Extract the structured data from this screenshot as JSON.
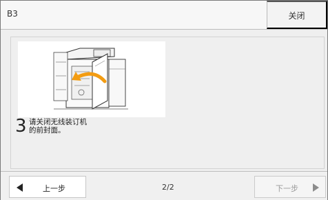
{
  "window": {
    "title": "B3"
  },
  "header": {
    "close_label": "关闭"
  },
  "step": {
    "number": "3",
    "text_line1": "请关闭无线装订机",
    "text_line2": "的前封面。"
  },
  "nav": {
    "prev_label": "上一步",
    "next_label": "下一步",
    "page": "2/2"
  },
  "colors": {
    "arrow": "#f39c12",
    "background": "#efefef"
  },
  "icons": {
    "prev": "triangle-left-icon",
    "next": "triangle-right-icon"
  }
}
